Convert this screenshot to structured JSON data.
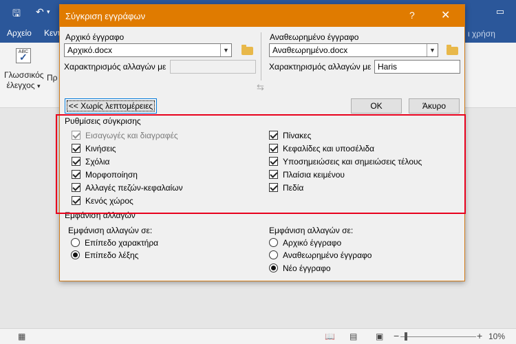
{
  "word": {
    "tabs": [
      "Αρχείο",
      "Κεντ"
    ],
    "tell_me": "ι χρήση",
    "proofing_button": "Γλωσσικός έλεγχος",
    "proofing_line1": "Γλωσσικός",
    "proofing_line2": "έλεγχος",
    "proofing_arrow": "▾",
    "ribbon_partial_label": "Πρ",
    "spell_icon_text": "ABC",
    "status": {
      "zoom": "10%"
    }
  },
  "dialog": {
    "title": "Σύγκριση εγγράφων",
    "help": "?",
    "close": "✕",
    "original": {
      "label": "Αρχικό έγγραφο",
      "file": "Αρχικό.docx",
      "label_changes": "Χαρακτηρισμός αλλαγών με",
      "author": ""
    },
    "revised": {
      "label": "Αναθεωρημένο έγγραφο",
      "file": "Αναθεωρημένο.docx",
      "label_changes": "Χαρακτηρισμός αλλαγών με",
      "author": "Haris"
    },
    "less_button": "<< Χωρίς λεπτομέρειες",
    "ok_button": "OK",
    "cancel_button": "Άκυρο",
    "comparison_settings": {
      "title": "Ρυθμίσεις σύγκρισης",
      "left": [
        {
          "label": "Εισαγωγές και διαγραφές",
          "checked": true,
          "disabled": true
        },
        {
          "label": "Κινήσεις",
          "checked": true
        },
        {
          "label": "Σχόλια",
          "checked": true
        },
        {
          "label": "Μορφοποίηση",
          "checked": true
        },
        {
          "label": "Αλλαγές πεζών-κεφαλαίων",
          "checked": true
        },
        {
          "label": "Κενός χώρος",
          "checked": true
        }
      ],
      "right": [
        {
          "label": "Πίνακες",
          "checked": true
        },
        {
          "label": "Κεφαλίδες και υποσέλιδα",
          "checked": true
        },
        {
          "label": "Υποσημειώσεις και σημειώσεις τέλους",
          "checked": true
        },
        {
          "label": "Πλαίσια κειμένου",
          "checked": true
        },
        {
          "label": "Πεδία",
          "checked": true
        }
      ]
    },
    "show_changes": {
      "title": "Εμφάνιση αλλαγών",
      "level_label": "Εμφάνιση αλλαγών σε:",
      "level_options": [
        {
          "label": "Επίπεδο χαρακτήρα",
          "selected": false
        },
        {
          "label": "Επίπεδο λέξης",
          "selected": true
        }
      ],
      "doc_label": "Εμφάνιση αλλαγών σε:",
      "doc_options": [
        {
          "label": "Αρχικό έγγραφο",
          "selected": false
        },
        {
          "label": "Αναθεωρημένο έγγραφο",
          "selected": false
        },
        {
          "label": "Νέο έγγραφο",
          "selected": true
        }
      ]
    }
  }
}
